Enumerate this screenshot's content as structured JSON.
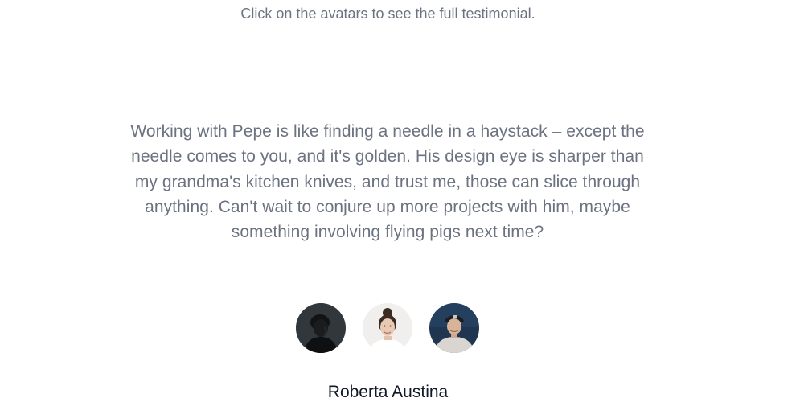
{
  "testimonials": {
    "instructions": "Click on the avatars to see the full testimonial.",
    "quote": "Working with Pepe is like finding a needle in a haystack – except the needle comes to you, and it's golden. His design eye is sharper than my grandma's kitchen knives, and trust me, those can slice through anything. Can't wait to conjure up more projects with him, maybe something involving flying pigs next time?",
    "active_name": "Roberta Austina",
    "avatars": [
      {
        "icon": "avatar-photo-dark-person",
        "background": "#2b2f33"
      },
      {
        "icon": "avatar-photo-woman-bun",
        "background": "#f0efed"
      },
      {
        "icon": "avatar-photo-man-cap",
        "background": "#1f3550"
      }
    ]
  }
}
